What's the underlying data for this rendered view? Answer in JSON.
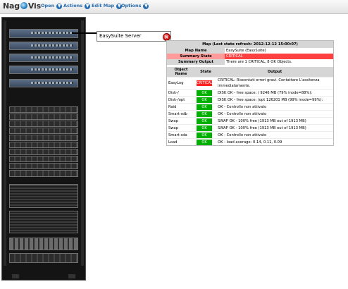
{
  "header": {
    "logo_pre": "Nag",
    "logo_post": "Vis",
    "menus": [
      "Open",
      "Actions",
      "Edit Map",
      "Options"
    ]
  },
  "host_label": {
    "name": "EasySuite Server",
    "status_icon": "error-icon",
    "status_color": "#d00000"
  },
  "popup": {
    "title": "Map (Last state refresh: 2012-12-12 15:00:07)",
    "summary": [
      {
        "label": "Map Name",
        "value": "EasySuite (EasySuite)"
      },
      {
        "label": "Summary State",
        "value": "CRITICAL"
      },
      {
        "label": "Summary Output",
        "value": "There are 1 CRITICAL, 8 OK Objects."
      }
    ],
    "columns": [
      "Object Name",
      "State",
      "Output"
    ],
    "rows": [
      {
        "name": "EasyLog",
        "state": "CRITICAL",
        "output": "CRITICAL: Riscontati errori gravi. Contattare L'assitenza immediatamente."
      },
      {
        "name": "Disk-/",
        "state": "OK",
        "output": "DISK OK - free space: / 9246 MB (79% inode=88%):"
      },
      {
        "name": "Disk-/opt",
        "state": "OK",
        "output": "DISK OK - free space: /opt 126201 MB (99% inode=99%):"
      },
      {
        "name": "Raid",
        "state": "OK",
        "output": "OK - Controllo non attivato"
      },
      {
        "name": "Smart-sdb",
        "state": "OK",
        "output": "OK - Controllo non attivato"
      },
      {
        "name": "Swap",
        "state": "OK",
        "output": "SWAP OK - 100% free (1913 MB out of 1913 MB)"
      },
      {
        "name": "Swap",
        "state": "OK",
        "output": "SWAP OK - 100% free (1913 MB out of 1913 MB)"
      },
      {
        "name": "Smart-sda",
        "state": "OK",
        "output": "OK - Controllo non attivato"
      },
      {
        "name": "Load",
        "state": "OK",
        "output": "OK - load average: 0.14, 0.11, 0.09"
      }
    ],
    "colors": {
      "ok": "#00b000",
      "critical": "#ff2020"
    }
  }
}
